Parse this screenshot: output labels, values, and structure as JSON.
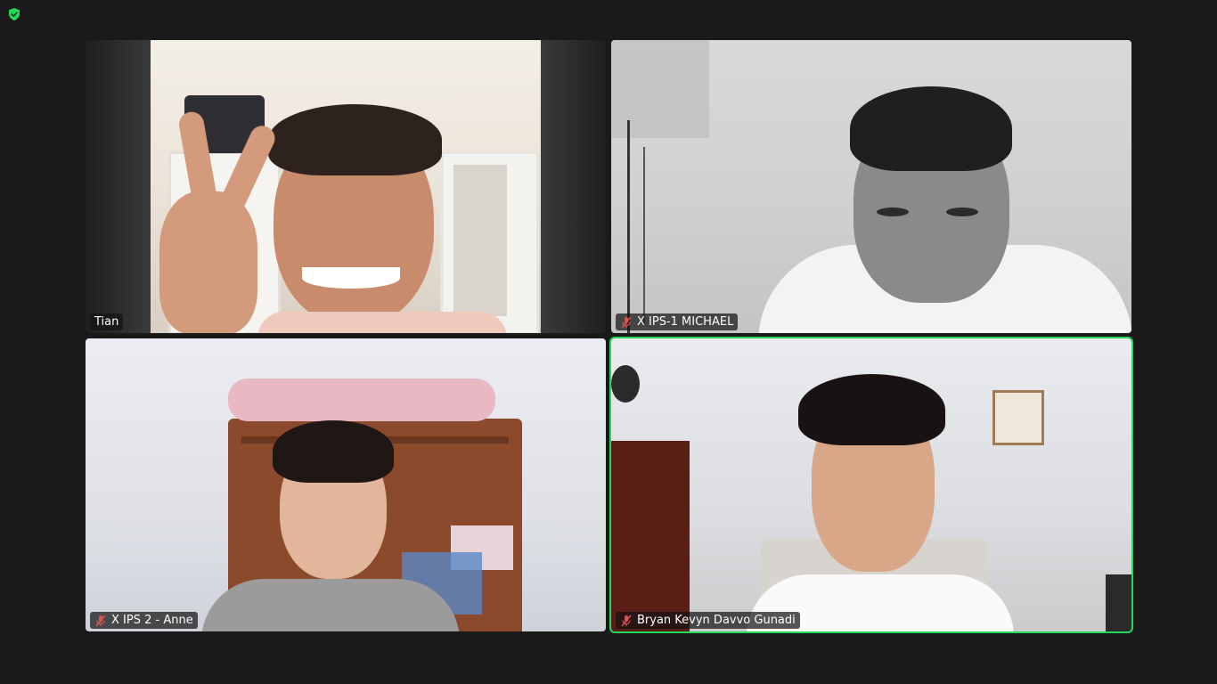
{
  "meeting": {
    "participants": [
      {
        "name": "Tian",
        "muted": false
      },
      {
        "name": "X IPS-1 MICHAEL",
        "muted": true
      },
      {
        "name": "X IPS 2 - Anne",
        "muted": true
      },
      {
        "name": "Bryan Kevyn Davvo Gunadi",
        "muted": true,
        "active_speaker": true
      }
    ],
    "active_speaker_color": "#23d959",
    "muted_icon_color": "#e0524e",
    "security_icon": "shield-check-icon",
    "security_icon_color": "#23d959"
  }
}
